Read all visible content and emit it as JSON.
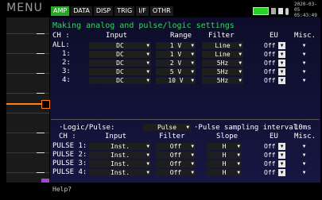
{
  "menu_label": "MENU",
  "tabs": [
    {
      "label": "AMP",
      "active": true
    },
    {
      "label": "DATA",
      "active": false
    },
    {
      "label": "DISP",
      "active": false
    },
    {
      "label": "TRIG",
      "active": false
    },
    {
      "label": "I/F",
      "active": false
    },
    {
      "label": "OTHR",
      "active": false
    }
  ],
  "datetime": {
    "date": "2020-03-05",
    "time": "05:43:49"
  },
  "title": "Making analog and pulse/logic settings",
  "analog": {
    "headers": {
      "ch": "CH :",
      "input": "Input",
      "range": "Range",
      "filter": "Filter",
      "eu": "EU",
      "misc": "Misc."
    },
    "rows": [
      {
        "label": "ALL:",
        "input": "DC",
        "range": "1 V",
        "filter": "Line",
        "eu": "Off"
      },
      {
        "label": "1:",
        "input": "DC",
        "range": "1 V",
        "filter": "Line",
        "eu": "Off"
      },
      {
        "label": "2:",
        "input": "DC",
        "range": "2 V",
        "filter": "5Hz",
        "eu": "Off"
      },
      {
        "label": "3:",
        "input": "DC",
        "range": "5 V",
        "filter": "5Hz",
        "eu": "Off"
      },
      {
        "label": "4:",
        "input": "DC",
        "range": "10 V",
        "filter": "5Hz",
        "eu": "Off"
      }
    ]
  },
  "logic": {
    "label": "·Logic/Pulse:",
    "mode": "Pulse",
    "interval_label": "·Pulse sampling interval",
    "interval_value": "10ms",
    "headers": {
      "ch": "CH :",
      "input": "Input",
      "filter": "Filter",
      "slope": "Slope",
      "eu": "EU",
      "misc": "Misc."
    },
    "rows": [
      {
        "label": "PULSE 1:",
        "input": "Inst.",
        "filter": "Off",
        "slope": "H",
        "eu": "Off"
      },
      {
        "label": "PULSE 2:",
        "input": "Inst.",
        "filter": "Off",
        "slope": "H",
        "eu": "Off"
      },
      {
        "label": "PULSE 3:",
        "input": "Inst.",
        "filter": "Off",
        "slope": "H",
        "eu": "Off"
      },
      {
        "label": "PULSE 4:",
        "input": "Inst.",
        "filter": "Off",
        "slope": "H",
        "eu": "Off"
      }
    ]
  },
  "help_text": "Help?",
  "colors": {
    "accent_green": "#2aa52a",
    "title_green": "#2cdc5a",
    "trace_orange": "#ff7e1c",
    "marker_purple": "#a045d8"
  }
}
